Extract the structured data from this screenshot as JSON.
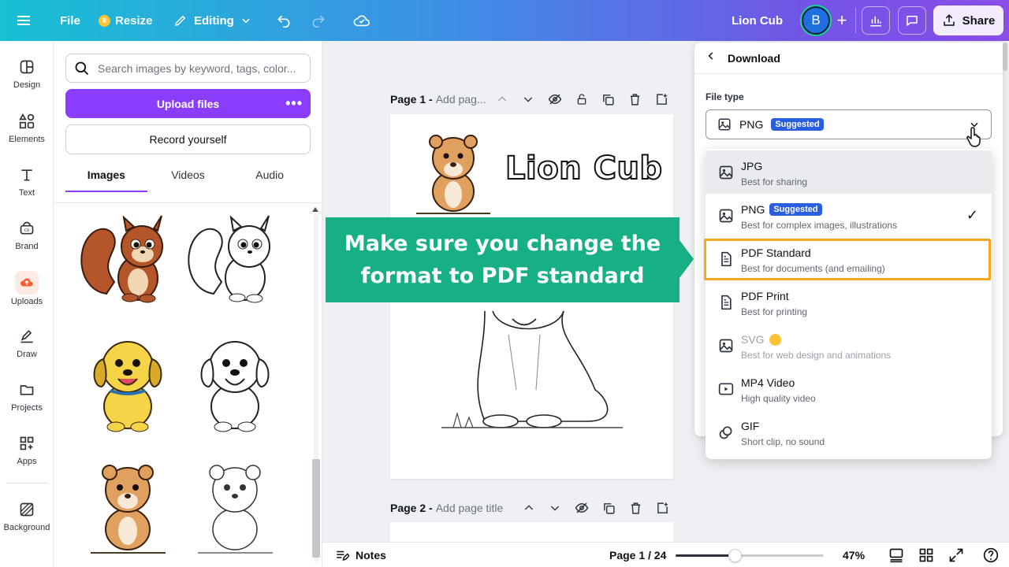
{
  "topbar": {
    "file_label": "File",
    "resize_label": "Resize",
    "editing_label": "Editing",
    "doc_title": "Lion Cub",
    "avatar_letter": "B",
    "share_label": "Share"
  },
  "rail": {
    "items": [
      {
        "label": "Design",
        "icon": "design-icon"
      },
      {
        "label": "Elements",
        "icon": "elements-icon"
      },
      {
        "label": "Text",
        "icon": "text-icon"
      },
      {
        "label": "Brand",
        "icon": "brand-icon"
      },
      {
        "label": "Uploads",
        "icon": "uploads-icon"
      },
      {
        "label": "Draw",
        "icon": "draw-icon"
      },
      {
        "label": "Projects",
        "icon": "projects-icon"
      },
      {
        "label": "Apps",
        "icon": "apps-icon"
      },
      {
        "label": "Background",
        "icon": "background-icon"
      }
    ]
  },
  "panel": {
    "search_placeholder": "Search images by keyword, tags, color...",
    "upload_label": "Upload files",
    "record_label": "Record yourself",
    "tabs": [
      "Images",
      "Videos",
      "Audio"
    ]
  },
  "canvas": {
    "page1_label": "Page 1 -",
    "page1_title_placeholder": "Add pag...",
    "page2_label": "Page 2 -",
    "page2_title_placeholder": "Add page title",
    "design_title": "Lion Cub",
    "callout_line1": "Make sure you change the",
    "callout_line2": "format to PDF standard"
  },
  "download": {
    "header": "Download",
    "file_type_label": "File type",
    "selected_value": "PNG",
    "selected_badge": "Suggested",
    "options": [
      {
        "title": "JPG",
        "subtitle": "Best for sharing"
      },
      {
        "title": "PNG",
        "badge": "Suggested",
        "subtitle": "Best for complex images, illustrations"
      },
      {
        "title": "PDF Standard",
        "subtitle": "Best for documents (and emailing)"
      },
      {
        "title": "PDF Print",
        "subtitle": "Best for printing"
      },
      {
        "title": "SVG",
        "subtitle": "Best for web design and animations"
      },
      {
        "title": "MP4 Video",
        "subtitle": "High quality video"
      },
      {
        "title": "GIF",
        "subtitle": "Short clip, no sound"
      }
    ]
  },
  "bottombar": {
    "notes_label": "Notes",
    "page_count": "Page 1 / 24",
    "zoom_pct": "47%",
    "zoom_fraction": 0.4
  },
  "colors": {
    "accent": "#8b3dff",
    "callout": "#17b086",
    "highlight": "#f5a623",
    "badge": "#2a5ee0"
  }
}
